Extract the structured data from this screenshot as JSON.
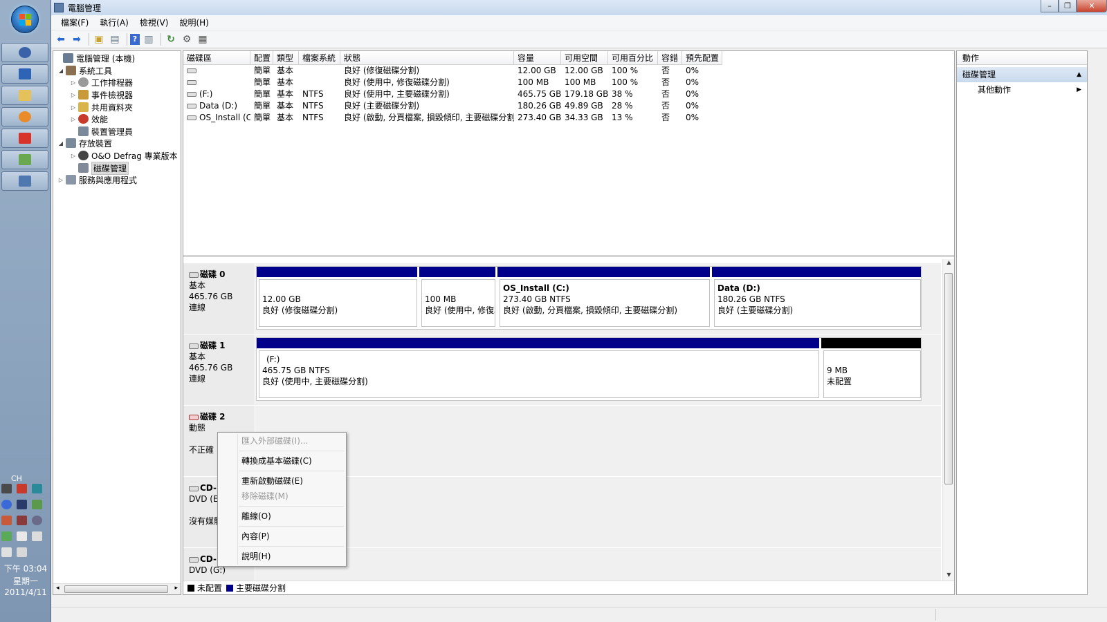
{
  "taskbar": {
    "tray": {
      "language": "CH",
      "time": "下午 03:04",
      "weekday": "星期一",
      "date": "2011/4/11"
    }
  },
  "window": {
    "title": "電腦管理",
    "controls": {
      "minimize": "–",
      "restore": "❐",
      "close": "✕"
    }
  },
  "menubar": {
    "items": [
      "檔案(F)",
      "執行(A)",
      "檢視(V)",
      "說明(H)"
    ]
  },
  "tree": {
    "nodes": [
      {
        "label": "電腦管理 (本機)",
        "icon": "computer-icon",
        "color": "#6a7c94"
      },
      {
        "label": "系統工具",
        "icon": "tools-icon",
        "color": "#8a7050"
      },
      {
        "label": "工作排程器",
        "icon": "clock-icon",
        "color": "#9a9a9a"
      },
      {
        "label": "事件檢視器",
        "icon": "event-viewer-icon",
        "color": "#c89a3a"
      },
      {
        "label": "共用資料夾",
        "icon": "shared-folder-icon",
        "color": "#d9b44a"
      },
      {
        "label": "效能",
        "icon": "performance-icon",
        "color": "#c83a2a"
      },
      {
        "label": "裝置管理員",
        "icon": "device-manager-icon",
        "color": "#7a8a9a"
      },
      {
        "label": "存放裝置",
        "icon": "storage-icon",
        "color": "#7a8a9a"
      },
      {
        "label": "O&O Defrag 專業版本",
        "icon": "defrag-icon",
        "color": "#444444"
      },
      {
        "label": "磁碟管理",
        "icon": "disk-management-icon",
        "color": "#808a98"
      },
      {
        "label": "服務與應用程式",
        "icon": "services-icon",
        "color": "#8a96a8"
      }
    ]
  },
  "volumes": {
    "columns": [
      "磁碟區",
      "配置",
      "類型",
      "檔案系統",
      "狀態",
      "容量",
      "可用空間",
      "可用百分比",
      "容錯",
      "預先配置"
    ],
    "rows": [
      [
        "",
        "簡單",
        "基本",
        "",
        "良好 (修復磁碟分割)",
        "12.00 GB",
        "12.00 GB",
        "100 %",
        "否",
        "0%"
      ],
      [
        "",
        "簡單",
        "基本",
        "",
        "良好 (使用中, 修復磁碟分割)",
        "100 MB",
        "100 MB",
        "100 %",
        "否",
        "0%"
      ],
      [
        "(F:)",
        "簡單",
        "基本",
        "NTFS",
        "良好 (使用中, 主要磁碟分割)",
        "465.75 GB",
        "179.18 GB",
        "38 %",
        "否",
        "0%"
      ],
      [
        "Data (D:)",
        "簡單",
        "基本",
        "NTFS",
        "良好 (主要磁碟分割)",
        "180.26 GB",
        "49.89 GB",
        "28 %",
        "否",
        "0%"
      ],
      [
        "OS_Install (C:)",
        "簡單",
        "基本",
        "NTFS",
        "良好 (啟動, 分頁檔案, 損毀傾印, 主要磁碟分割)",
        "273.40 GB",
        "34.33 GB",
        "13 %",
        "否",
        "0%"
      ]
    ]
  },
  "disks": [
    {
      "name": "磁碟 0",
      "type": "基本",
      "size": "465.76 GB",
      "status": "連線",
      "partitions": [
        {
          "name": "",
          "size": "12.00 GB",
          "status": "良好 (修復磁碟分割)"
        },
        {
          "name": "",
          "size": "100 MB",
          "status": "良好 (使用中, 修復ｴ"
        },
        {
          "name": "OS_Install  (C:)",
          "size": "273.40 GB NTFS",
          "status": "良好 (啟動, 分頁檔案, 損毀傾印, 主要磁碟分割)"
        },
        {
          "name": "Data  (D:)",
          "size": "180.26 GB NTFS",
          "status": "良好 (主要磁碟分割)"
        }
      ]
    },
    {
      "name": "磁碟 1",
      "type": "基本",
      "size": "465.76 GB",
      "status": "連線",
      "partitions": [
        {
          "name": "(F:)",
          "size": "465.75 GB NTFS",
          "status": "良好 (使用中, 主要磁碟分割)"
        },
        {
          "name": "",
          "size": "9 MB",
          "status": "未配置"
        }
      ]
    },
    {
      "name": "磁碟 2",
      "type": "動態",
      "status": "不正確"
    },
    {
      "name": "CD-I",
      "type": "DVD (E:",
      "status": "沒有媒體"
    },
    {
      "name": "CD-I",
      "type": "DVD (G:)"
    }
  ],
  "legend": {
    "items": [
      {
        "label": "未配置",
        "color": "#000000"
      },
      {
        "label": "主要磁碟分割",
        "color": "#00008b"
      }
    ]
  },
  "context_menu": {
    "items": [
      {
        "label": "匯入外部磁碟(I)...",
        "enabled": false
      },
      {
        "label": "轉換成基本磁碟(C)",
        "enabled": true
      },
      {
        "label": "重新啟動磁碟(E)",
        "enabled": true
      },
      {
        "label": "移除磁碟(M)",
        "enabled": false
      },
      {
        "label": "離線(O)",
        "enabled": true
      },
      {
        "label": "內容(P)",
        "enabled": true
      },
      {
        "label": "說明(H)",
        "enabled": true
      }
    ]
  },
  "actions": {
    "header": "動作",
    "section": "磁碟管理",
    "item": "其他動作"
  },
  "colors": {
    "primary_partition": "#00008b",
    "unallocated": "#000000",
    "selection": "#c9d9ed"
  }
}
